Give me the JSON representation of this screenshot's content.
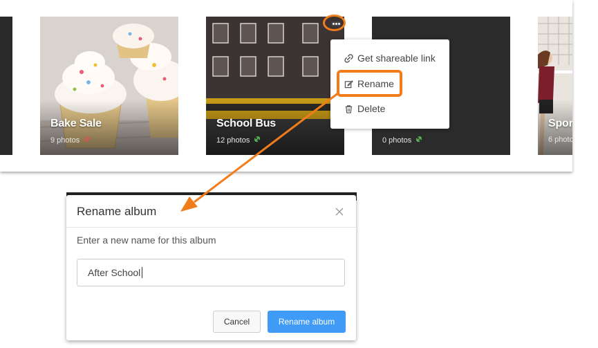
{
  "albums": [
    {
      "name": "Bake Sale",
      "photos": "9 photos",
      "link_color": "#d9534f"
    },
    {
      "name": "School Bus",
      "photos": "12 photos",
      "link_color": "#5cb85c"
    },
    {
      "name": "",
      "photos": "0 photos",
      "link_color": "#5cb85c"
    },
    {
      "name": "Spor",
      "photos": "6 photo",
      "link_color": "#5cb85c"
    }
  ],
  "menu": {
    "items": [
      {
        "label": "Get shareable link",
        "icon": "link-icon"
      },
      {
        "label": "Rename",
        "icon": "edit-icon"
      },
      {
        "label": "Delete",
        "icon": "trash-icon"
      }
    ]
  },
  "modal": {
    "title": "Rename album",
    "label": "Enter a new name for this album",
    "input_value": "After School",
    "cancel": "Cancel",
    "confirm": "Rename album"
  },
  "colors": {
    "highlight": "#f07d1a",
    "primary": "#3f9bf5"
  }
}
